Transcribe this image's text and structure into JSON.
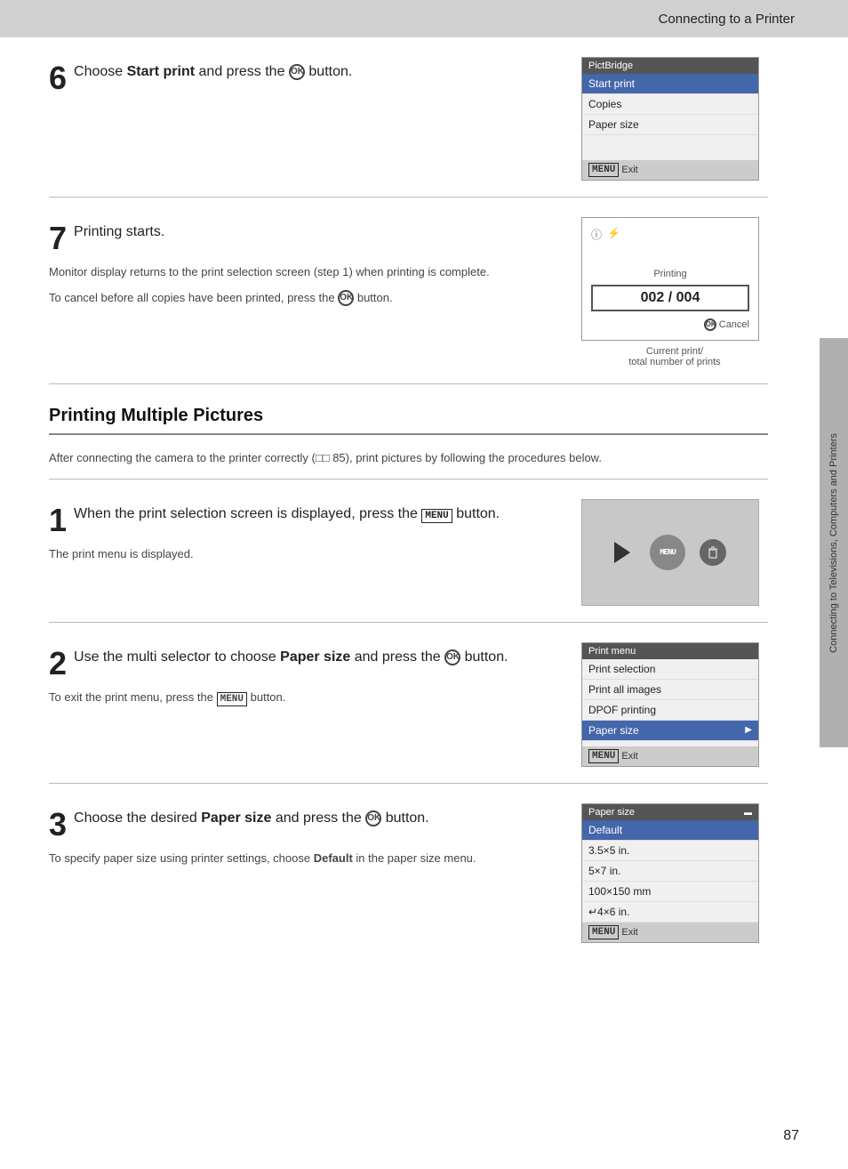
{
  "header": {
    "title": "Connecting to a Printer",
    "background_color": "#d0d0d0"
  },
  "page_number": "87",
  "side_tab_text": "Connecting to Televisions, Computers and Printers",
  "step6": {
    "number": "6",
    "title_pre": "Choose ",
    "title_bold": "Start print",
    "title_post": " and press the",
    "title_suffix": " button.",
    "screen_title": "PictBridge",
    "screen_items": [
      {
        "label": "Start print",
        "selected": true
      },
      {
        "label": "Copies",
        "selected": false
      },
      {
        "label": "Paper size",
        "selected": false
      }
    ],
    "screen_footer": "Exit"
  },
  "step7": {
    "number": "7",
    "title": "Printing starts.",
    "body1": "Monitor display returns to the print selection screen (step 1) when printing is complete.",
    "body2_pre": "To cancel before all copies have been printed, press the",
    "body2_post": " button.",
    "print_label": "Printing",
    "print_counter": "002 / 004",
    "print_cancel": "Cancel",
    "caption_line1": "Current print/",
    "caption_line2": "total number of prints"
  },
  "section_heading": "Printing Multiple Pictures",
  "section_intro": "After connecting the camera to the printer correctly (□□ 85), print pictures by following the procedures below.",
  "step1": {
    "number": "1",
    "title_pre": "When the print selection screen is displayed, press the ",
    "title_menu": "MENU",
    "title_post": " button.",
    "body": "The print menu is displayed."
  },
  "step2": {
    "number": "2",
    "title_pre": "Use the multi selector to choose ",
    "title_bold": "Paper size",
    "title_post": " and press the",
    "title_suffix": " button.",
    "body_pre": "To exit the print menu, press the ",
    "body_menu": "MENU",
    "body_post": " button.",
    "screen_title": "Print menu",
    "screen_items": [
      {
        "label": "Print selection",
        "selected": false
      },
      {
        "label": "Print all images",
        "selected": false
      },
      {
        "label": "DPOF printing",
        "selected": false
      },
      {
        "label": "Paper size",
        "selected": true,
        "has_arrow": true
      }
    ],
    "screen_footer": "Exit"
  },
  "step3": {
    "number": "3",
    "title_pre": "Choose the desired ",
    "title_bold": "Paper size",
    "title_post": " and press the",
    "title_suffix": " button.",
    "body_bold": "Default",
    "body_pre": "To specify paper size using printer settings, choose ",
    "body_post": " in the paper size menu.",
    "screen_title": "Paper size",
    "screen_items": [
      {
        "label": "Default",
        "selected": true
      },
      {
        "label": "3.5×5 in.",
        "selected": false
      },
      {
        "label": "5×7 in.",
        "selected": false
      },
      {
        "label": "100×150 mm",
        "selected": false
      },
      {
        "label": "↵4×6 in.",
        "selected": false
      }
    ],
    "screen_footer": "Exit"
  }
}
